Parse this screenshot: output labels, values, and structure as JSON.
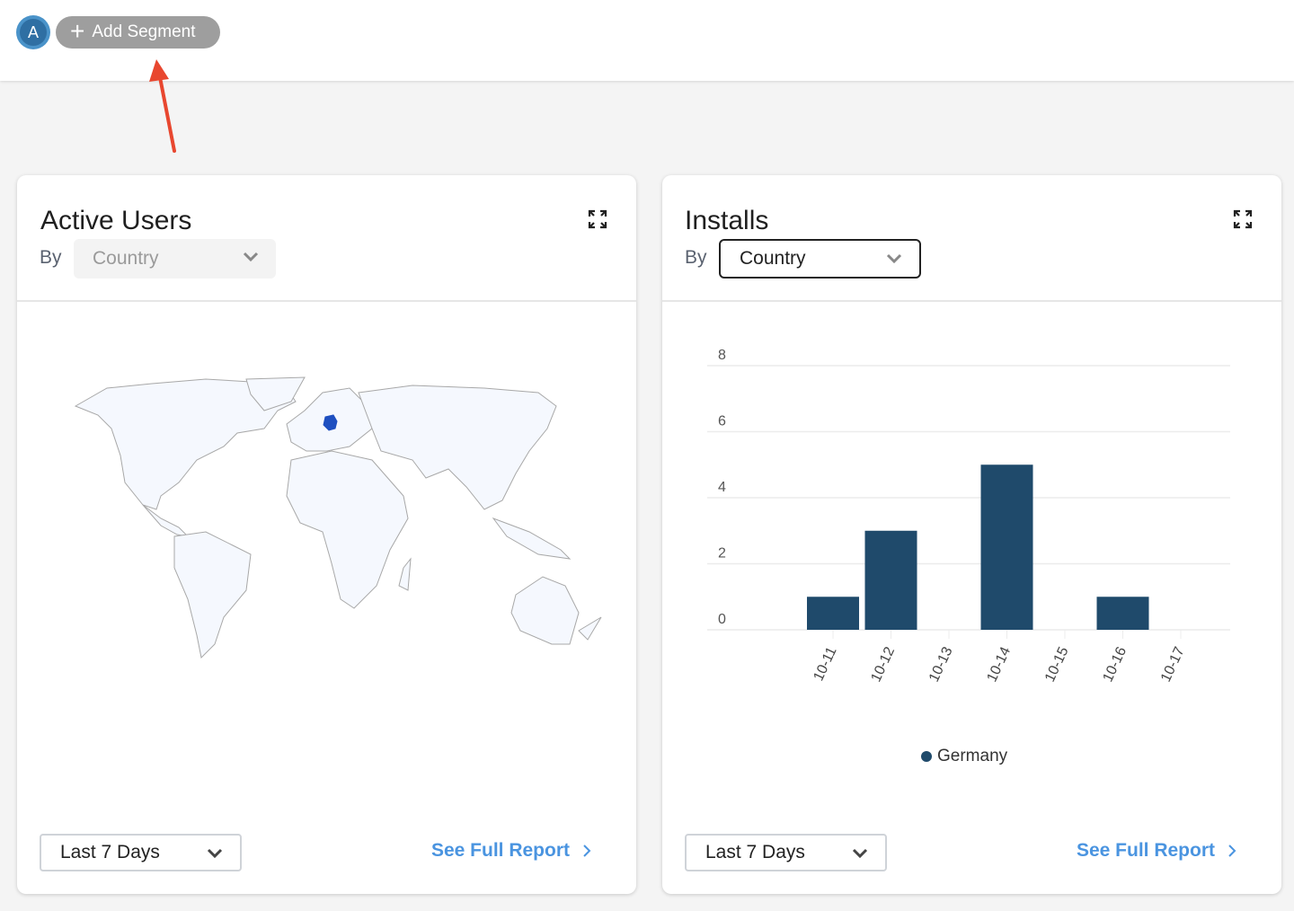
{
  "topbar": {
    "avatar_letter": "A",
    "add_segment_label": "Add Segment"
  },
  "colors": {
    "accent_link": "#4a94e0",
    "bar": "#1f4a6b",
    "highlight_country": "#1e4fc0",
    "arrow": "#e8472f"
  },
  "cards": [
    {
      "title": "Active Users",
      "by_label": "By",
      "by_value": "Country",
      "by_disabled": true,
      "date_range": "Last 7 Days",
      "report_link": "See Full Report",
      "map": {
        "highlighted_country": "Germany"
      }
    },
    {
      "title": "Installs",
      "by_label": "By",
      "by_value": "Country",
      "by_disabled": false,
      "date_range": "Last 7 Days",
      "report_link": "See Full Report"
    }
  ],
  "chart_data": {
    "type": "bar",
    "title": "Installs",
    "categories": [
      "10-11",
      "10-12",
      "10-13",
      "10-14",
      "10-15",
      "10-16",
      "10-17"
    ],
    "series": [
      {
        "name": "Germany",
        "values": [
          1,
          3,
          0,
          5,
          0,
          1,
          0
        ]
      }
    ],
    "yticks": [
      "0",
      "2",
      "4",
      "6",
      "8"
    ],
    "ylim": [
      0,
      8
    ],
    "xlabel": "",
    "ylabel": "",
    "grid": true,
    "legend": "bottom-center"
  }
}
